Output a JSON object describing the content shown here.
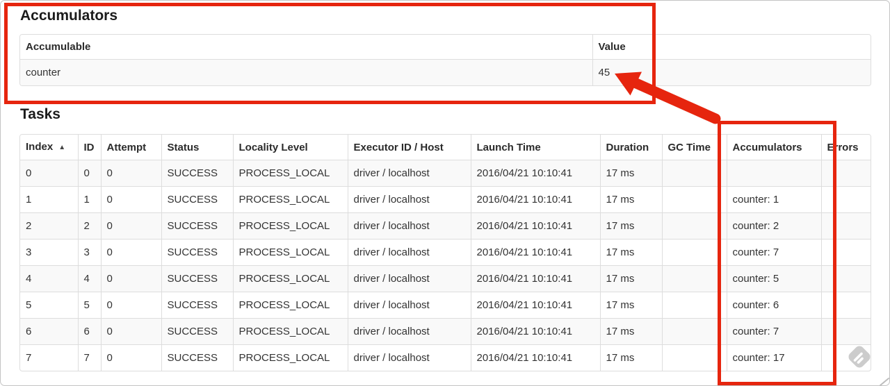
{
  "page": {
    "accumulators_heading": "Accumulators",
    "tasks_heading": "Tasks"
  },
  "accumulators_table": {
    "columns": [
      "Accumulable",
      "Value"
    ],
    "rows": [
      [
        "counter",
        "45"
      ]
    ]
  },
  "tasks_table": {
    "columns": [
      "Index",
      "ID",
      "Attempt",
      "Status",
      "Locality Level",
      "Executor ID / Host",
      "Launch Time",
      "Duration",
      "GC Time",
      "Accumulators",
      "Errors"
    ],
    "sort_icon": "▲",
    "rows": [
      [
        "0",
        "0",
        "0",
        "SUCCESS",
        "PROCESS_LOCAL",
        "driver / localhost",
        "2016/04/21 10:10:41",
        "17 ms",
        "",
        "",
        ""
      ],
      [
        "1",
        "1",
        "0",
        "SUCCESS",
        "PROCESS_LOCAL",
        "driver / localhost",
        "2016/04/21 10:10:41",
        "17 ms",
        "",
        "counter: 1",
        ""
      ],
      [
        "2",
        "2",
        "0",
        "SUCCESS",
        "PROCESS_LOCAL",
        "driver / localhost",
        "2016/04/21 10:10:41",
        "17 ms",
        "",
        "counter: 2",
        ""
      ],
      [
        "3",
        "3",
        "0",
        "SUCCESS",
        "PROCESS_LOCAL",
        "driver / localhost",
        "2016/04/21 10:10:41",
        "17 ms",
        "",
        "counter: 7",
        ""
      ],
      [
        "4",
        "4",
        "0",
        "SUCCESS",
        "PROCESS_LOCAL",
        "driver / localhost",
        "2016/04/21 10:10:41",
        "17 ms",
        "",
        "counter: 5",
        ""
      ],
      [
        "5",
        "5",
        "0",
        "SUCCESS",
        "PROCESS_LOCAL",
        "driver / localhost",
        "2016/04/21 10:10:41",
        "17 ms",
        "",
        "counter: 6",
        ""
      ],
      [
        "6",
        "6",
        "0",
        "SUCCESS",
        "PROCESS_LOCAL",
        "driver / localhost",
        "2016/04/21 10:10:41",
        "17 ms",
        "",
        "counter: 7",
        ""
      ],
      [
        "7",
        "7",
        "0",
        "SUCCESS",
        "PROCESS_LOCAL",
        "driver / localhost",
        "2016/04/21 10:10:41",
        "17 ms",
        "",
        "counter: 17",
        ""
      ]
    ]
  },
  "colors": {
    "annotation_red": "#e6250e",
    "row_stripe": "#f9f9f9",
    "table_border": "#dddddd"
  }
}
